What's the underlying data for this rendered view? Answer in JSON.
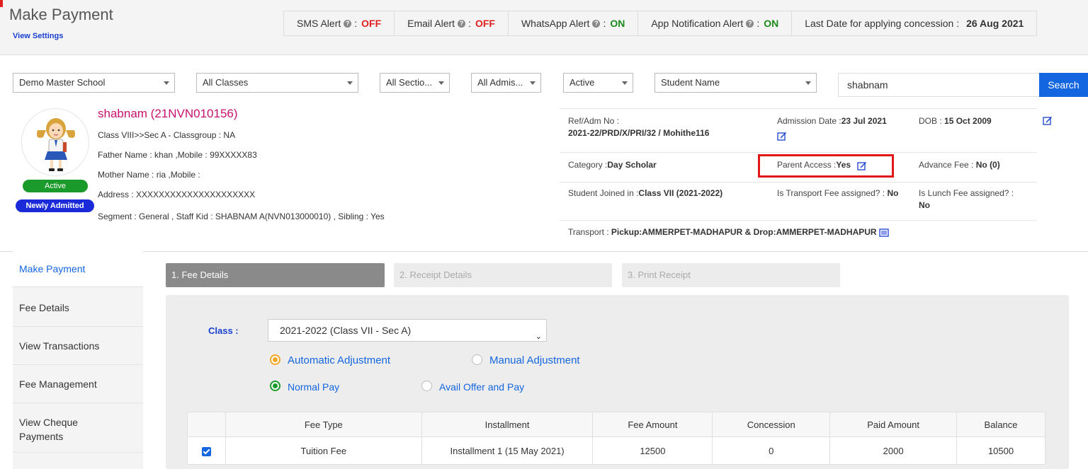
{
  "header": {
    "title": "Make Payment",
    "view_settings": "View Settings",
    "alerts": [
      {
        "label": "SMS Alert",
        "sep": ":",
        "status": "OFF"
      },
      {
        "label": "Email Alert",
        "sep": ":",
        "status": "OFF"
      },
      {
        "label": "WhatsApp Alert",
        "sep": ":",
        "status": "ON"
      },
      {
        "label": "App Notification Alert",
        "sep": ":",
        "status": "ON"
      }
    ],
    "concession_label": "Last Date for applying concession :",
    "concession_date": "26 Aug 2021"
  },
  "filters": {
    "school": "Demo Master School",
    "classes": "All Classes",
    "sections": "All Sectio...",
    "admissions": "All Admis...",
    "status": "Active",
    "search_by": "Student Name",
    "search_value": "shabnam",
    "search_button": "Search"
  },
  "student": {
    "name": "shabnam  (21NVN010156)",
    "class_line": "Class VIII>>Sec A - Classgroup : NA",
    "father_line": "Father Name : khan ,Mobile : 99XXXXX83",
    "mother_line": "Mother Name : ria ,Mobile :",
    "address_line": "Address : XXXXXXXXXXXXXXXXXXXXX",
    "segment_line": "Segment : General  ,  Staff Kid : SHABNAM A(NVN013000010)   ,  Sibling : Yes",
    "badge_active": "Active",
    "badge_new": "Newly Admitted"
  },
  "details": {
    "ref_label": "Ref/Adm No :",
    "ref_value": "2021-22/PRD/X/PRI/32 / Mohithe116",
    "admission_label": "Admission Date :",
    "admission_value": "23 Jul 2021",
    "dob_label": "DOB :",
    "dob_value": "15 Oct 2009",
    "category_label": "Category :",
    "category_value": "Day Scholar",
    "parent_access_label": "Parent Access :",
    "parent_access_value": "Yes",
    "advance_label": "Advance Fee :",
    "advance_value": "No (0)",
    "joined_label": "Student Joined in :",
    "joined_value": "Class VII (2021-2022)",
    "transport_assigned_label": "Is Transport Fee assigned? :",
    "transport_assigned_value": "No",
    "lunch_label": "Is Lunch Fee assigned? :",
    "lunch_value": "No",
    "transport_label": "Transport :",
    "transport_value": "Pickup:AMMERPET-MADHAPUR & Drop:AMMERPET-MADHAPUR"
  },
  "nav": {
    "items": [
      "Make Payment",
      "Fee Details",
      "View Transactions",
      "Fee Management",
      "View Cheque Payments"
    ]
  },
  "steps": [
    "1. Fee Details",
    "2. Receipt Details",
    "3. Print Receipt"
  ],
  "form": {
    "class_label": "Class :",
    "class_value": "2021-2022 (Class VII - Sec A)",
    "auto_adjust": "Automatic Adjustment",
    "manual_adjust": "Manual Adjustment",
    "normal_pay": "Normal Pay",
    "offer_pay": "Avail Offer and Pay"
  },
  "table": {
    "headers": [
      "Fee Type",
      "Installment",
      "Fee Amount",
      "Concession",
      "Paid Amount",
      "Balance"
    ],
    "rows": [
      [
        "Tuition Fee",
        "Installment 1 (15 May 2021)",
        "12500",
        "0",
        "2000",
        "10500"
      ]
    ]
  },
  "colors": {
    "primary": "#1466e0",
    "student_name": "#c8106e",
    "off": "#e02020",
    "on": "#1a8a1a",
    "highlight": "#e01818"
  }
}
